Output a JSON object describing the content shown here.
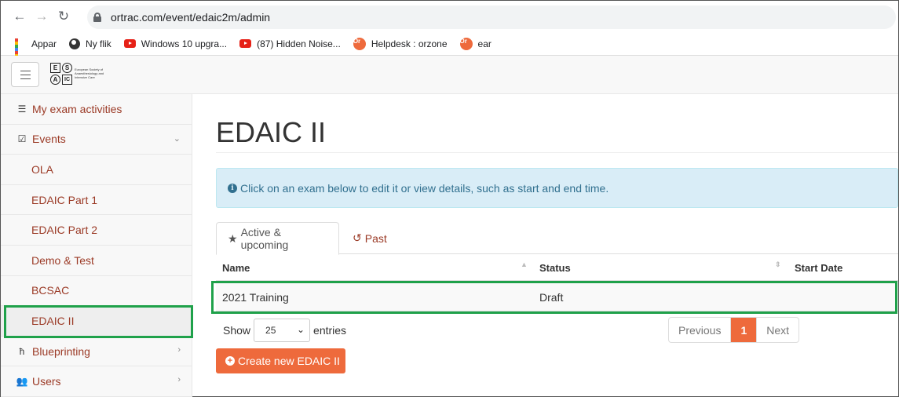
{
  "browser": {
    "url": "ortrac.com/event/edaic2m/admin",
    "bookmarks": [
      {
        "label": "Appar",
        "icon": "apps-grid-icon"
      },
      {
        "label": "Ny flik",
        "icon": "globe-icon"
      },
      {
        "label": "Windows 10 upgra...",
        "icon": "youtube-icon"
      },
      {
        "label": "(87) Hidden Noise...",
        "icon": "youtube-icon"
      },
      {
        "label": "Helpdesk : orzone",
        "icon": "ortrac-icon"
      },
      {
        "label": "ear",
        "icon": "ortrac-icon"
      }
    ]
  },
  "logo": {
    "letters": [
      "E",
      "S",
      "A",
      "IC"
    ],
    "text": "European Society of Anaesthesiology and Intensive Care"
  },
  "sidebar": {
    "items": [
      {
        "label": "My exam activities",
        "icon": "list-icon"
      },
      {
        "label": "Events",
        "icon": "checkbox-icon",
        "chevron": "⌄"
      },
      {
        "label": "OLA"
      },
      {
        "label": "EDAIC Part 1"
      },
      {
        "label": "EDAIC Part 2"
      },
      {
        "label": "Demo & Test"
      },
      {
        "label": "BCSAC"
      },
      {
        "label": "EDAIC II"
      },
      {
        "label": "Blueprinting",
        "icon": "blueprint-icon",
        "chevron": "›"
      },
      {
        "label": "Users",
        "icon": "users-icon",
        "chevron": "›"
      }
    ]
  },
  "main": {
    "title": "EDAIC II",
    "alert": "Click on an exam below to edit it or view details, such as start and end time.",
    "tabs": [
      {
        "label": "Active & upcoming",
        "icon": "star-icon"
      },
      {
        "label": "Past",
        "icon": "history-icon"
      }
    ],
    "table": {
      "columns": [
        "Name",
        "Status",
        "Start Date"
      ],
      "rows": [
        {
          "name": "2021 Training",
          "status": "Draft",
          "start_date": ""
        }
      ]
    },
    "length": {
      "show": "Show",
      "value": "25",
      "entries": "entries"
    },
    "pager": {
      "previous": "Previous",
      "current": "1",
      "next": "Next"
    },
    "create_button": "Create new EDAIC II"
  },
  "colors": {
    "accent": "#ee6a3c",
    "link": "#9b3a26",
    "highlight": "#1fa14a",
    "alert_bg": "#d9edf7"
  }
}
